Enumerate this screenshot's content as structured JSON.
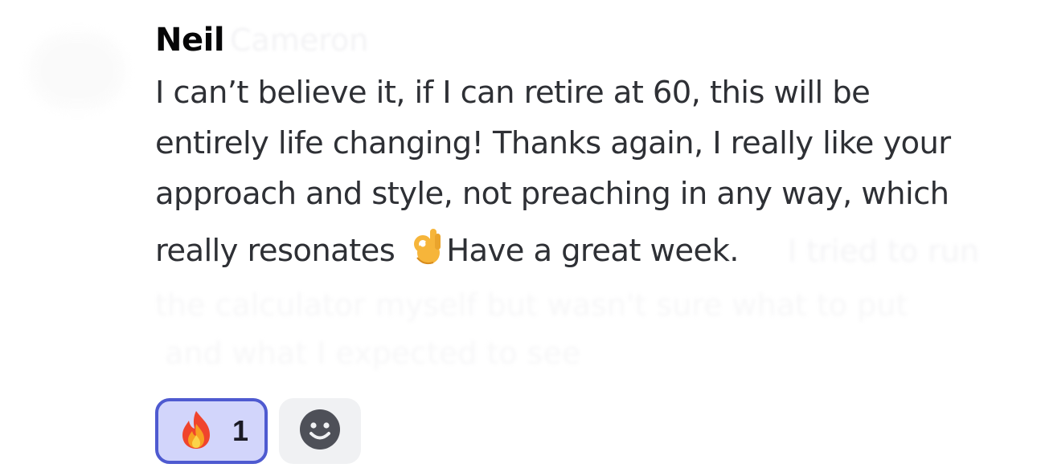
{
  "message": {
    "author": "Neil",
    "line1": "I can’t believe it, if I can retire at 60, this will be",
    "line2": "entirely life changing! Thanks again, I really like your",
    "line3": "approach and style, not preaching in any way, which",
    "line4_before_emoji": "really resonates",
    "inline_emoji": "ok-hand-emoji",
    "line4_after_emoji": "Have a great week."
  },
  "reactions": [
    {
      "emoji": "fire-emoji",
      "count": "1",
      "selected": true
    }
  ],
  "add_reaction_icon": "smiley-face-icon",
  "colors": {
    "reaction_selected_bg": "#d2d5fb",
    "reaction_selected_border": "#4e5ad0",
    "text": "#2e3035",
    "author": "#060607"
  }
}
